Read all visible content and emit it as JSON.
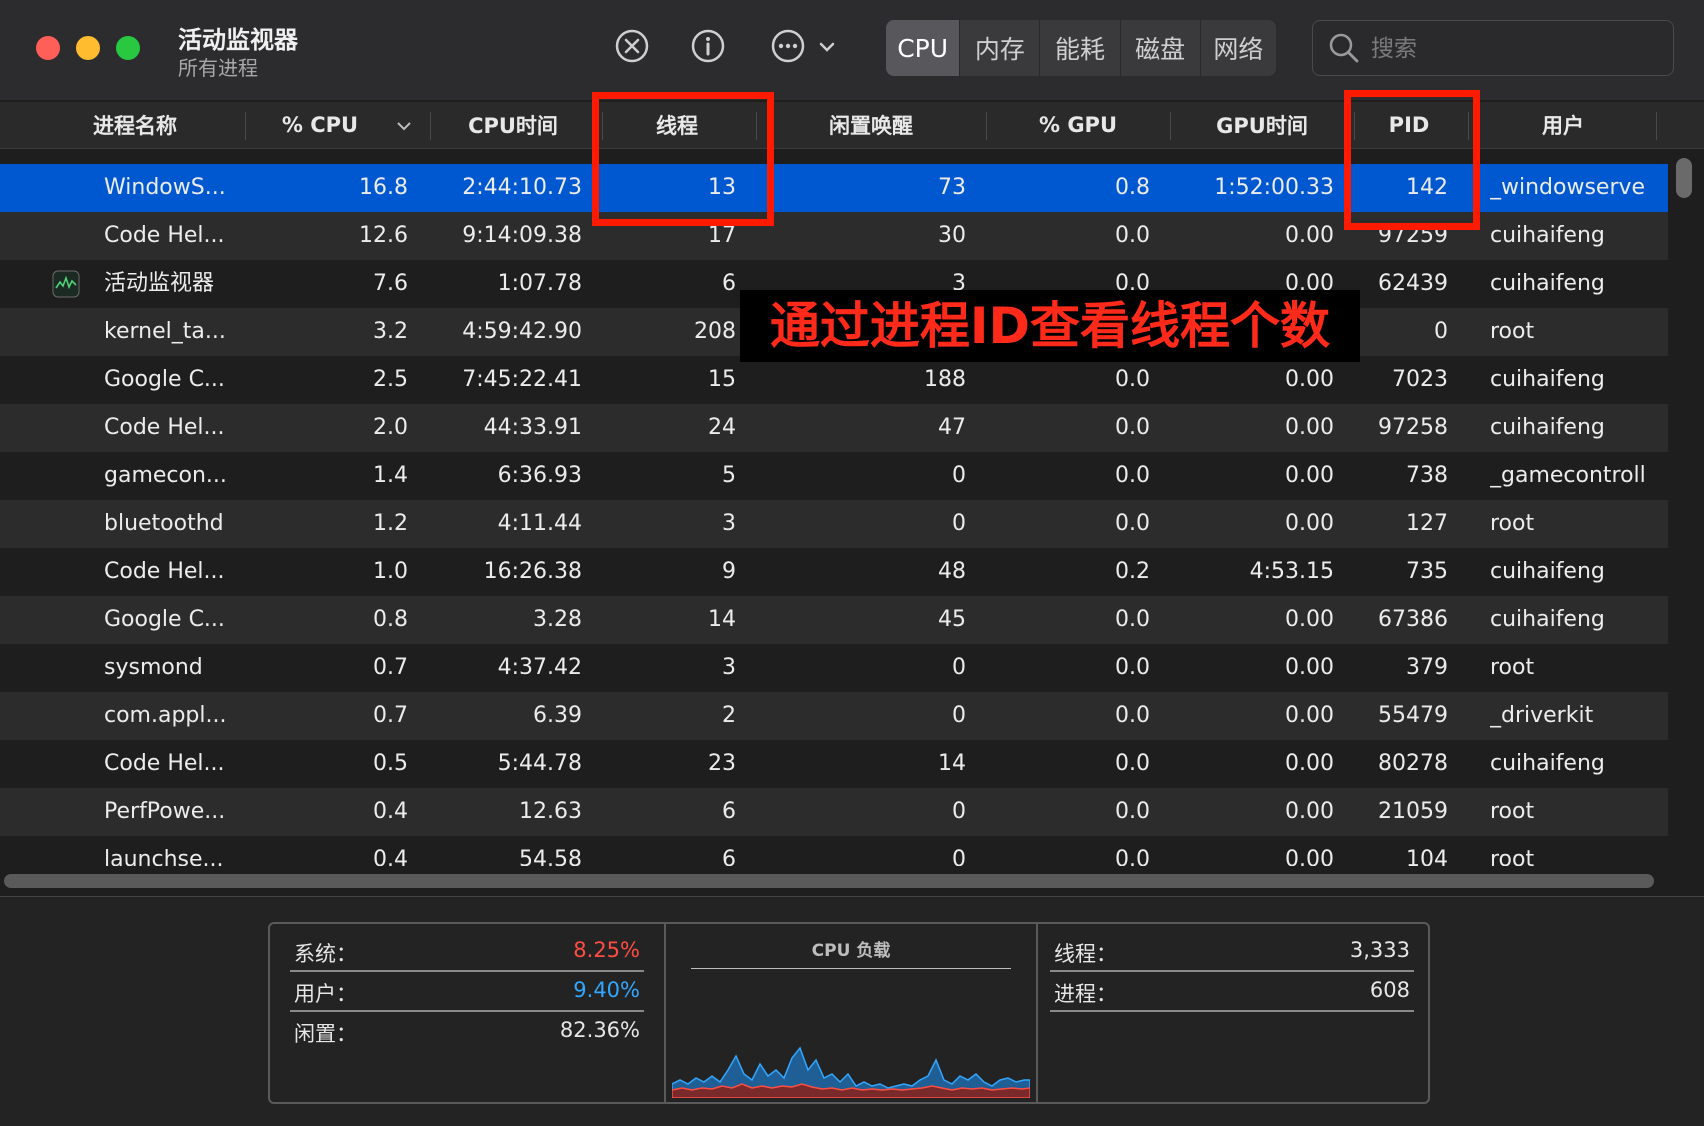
{
  "app": {
    "title": "活动监视器",
    "subtitle": "所有进程"
  },
  "toolbar": {
    "icons": [
      "stop-process-icon",
      "info-icon",
      "more-actions-icon",
      "chevron-down-icon"
    ],
    "tabs": [
      {
        "label": "CPU",
        "active": true
      },
      {
        "label": "内存",
        "active": false
      },
      {
        "label": "能耗",
        "active": false
      },
      {
        "label": "磁盘",
        "active": false
      },
      {
        "label": "网络",
        "active": false
      }
    ],
    "search_placeholder": "搜索"
  },
  "table": {
    "columns": [
      "进程名称",
      "% CPU",
      "CPU时间",
      "线程",
      "闲置唤醒",
      "% GPU",
      "GPU时间",
      "PID",
      "用户"
    ],
    "sorted_by": "% CPU",
    "rows": [
      {
        "name": "WindowS...",
        "cpu": "16.8",
        "cpu_time": "2:44:10.73",
        "threads": "13",
        "idle_wakeups": "73",
        "gpu": "0.8",
        "gpu_time": "1:52:00.33",
        "pid": "142",
        "user": "_windowserver",
        "selected": true
      },
      {
        "name": "Code Hel...",
        "cpu": "12.6",
        "cpu_time": "9:14:09.38",
        "threads": "17",
        "idle_wakeups": "30",
        "gpu": "0.0",
        "gpu_time": "0.00",
        "pid": "97259",
        "user": "cuihaifeng"
      },
      {
        "name": "活动监视器",
        "cpu": "7.6",
        "cpu_time": "1:07.78",
        "threads": "6",
        "idle_wakeups": "3",
        "gpu": "0.0",
        "gpu_time": "0.00",
        "pid": "62439",
        "user": "cuihaifeng",
        "has_icon": true
      },
      {
        "name": "kernel_ta...",
        "cpu": "3.2",
        "cpu_time": "4:59:42.90",
        "threads": "208",
        "idle_wakeups": "",
        "gpu": "",
        "gpu_time": "",
        "pid": "0",
        "user": "root"
      },
      {
        "name": "Google C...",
        "cpu": "2.5",
        "cpu_time": "7:45:22.41",
        "threads": "15",
        "idle_wakeups": "188",
        "gpu": "0.0",
        "gpu_time": "0.00",
        "pid": "7023",
        "user": "cuihaifeng"
      },
      {
        "name": "Code Hel...",
        "cpu": "2.0",
        "cpu_time": "44:33.91",
        "threads": "24",
        "idle_wakeups": "47",
        "gpu": "0.0",
        "gpu_time": "0.00",
        "pid": "97258",
        "user": "cuihaifeng"
      },
      {
        "name": "gamecon...",
        "cpu": "1.4",
        "cpu_time": "6:36.93",
        "threads": "5",
        "idle_wakeups": "0",
        "gpu": "0.0",
        "gpu_time": "0.00",
        "pid": "738",
        "user": "_gamecontrolle"
      },
      {
        "name": "bluetoothd",
        "cpu": "1.2",
        "cpu_time": "4:11.44",
        "threads": "3",
        "idle_wakeups": "0",
        "gpu": "0.0",
        "gpu_time": "0.00",
        "pid": "127",
        "user": "root"
      },
      {
        "name": "Code Hel...",
        "cpu": "1.0",
        "cpu_time": "16:26.38",
        "threads": "9",
        "idle_wakeups": "48",
        "gpu": "0.2",
        "gpu_time": "4:53.15",
        "pid": "735",
        "user": "cuihaifeng"
      },
      {
        "name": "Google C...",
        "cpu": "0.8",
        "cpu_time": "3.28",
        "threads": "14",
        "idle_wakeups": "45",
        "gpu": "0.0",
        "gpu_time": "0.00",
        "pid": "67386",
        "user": "cuihaifeng"
      },
      {
        "name": "sysmond",
        "cpu": "0.7",
        "cpu_time": "4:37.42",
        "threads": "3",
        "idle_wakeups": "0",
        "gpu": "0.0",
        "gpu_time": "0.00",
        "pid": "379",
        "user": "root"
      },
      {
        "name": "com.appl...",
        "cpu": "0.7",
        "cpu_time": "6.39",
        "threads": "2",
        "idle_wakeups": "0",
        "gpu": "0.0",
        "gpu_time": "0.00",
        "pid": "55479",
        "user": "_driverkit"
      },
      {
        "name": "Code Hel...",
        "cpu": "0.5",
        "cpu_time": "5:44.78",
        "threads": "23",
        "idle_wakeups": "14",
        "gpu": "0.0",
        "gpu_time": "0.00",
        "pid": "80278",
        "user": "cuihaifeng"
      },
      {
        "name": "PerfPowe...",
        "cpu": "0.4",
        "cpu_time": "12.63",
        "threads": "6",
        "idle_wakeups": "0",
        "gpu": "0.0",
        "gpu_time": "0.00",
        "pid": "21059",
        "user": "root"
      },
      {
        "name": "launchse...",
        "cpu": "0.4",
        "cpu_time": "54.58",
        "threads": "6",
        "idle_wakeups": "0",
        "gpu": "0.0",
        "gpu_time": "0.00",
        "pid": "104",
        "user": "root"
      }
    ]
  },
  "summary": {
    "system_label": "系统：",
    "system_value": "8.25%",
    "user_label": "用户：",
    "user_value": "9.40%",
    "idle_label": "闲置：",
    "idle_value": "82.36%",
    "chart_title": "CPU 负载",
    "threads_label": "线程：",
    "threads_value": "3,333",
    "processes_label": "进程：",
    "processes_value": "608"
  },
  "annotation": {
    "text": "通过进程ID查看线程个数"
  },
  "colors": {
    "selection": "#0058d0",
    "system": "#ff4d42",
    "user": "#33a7ff",
    "annotation": "#ff2a1a"
  }
}
